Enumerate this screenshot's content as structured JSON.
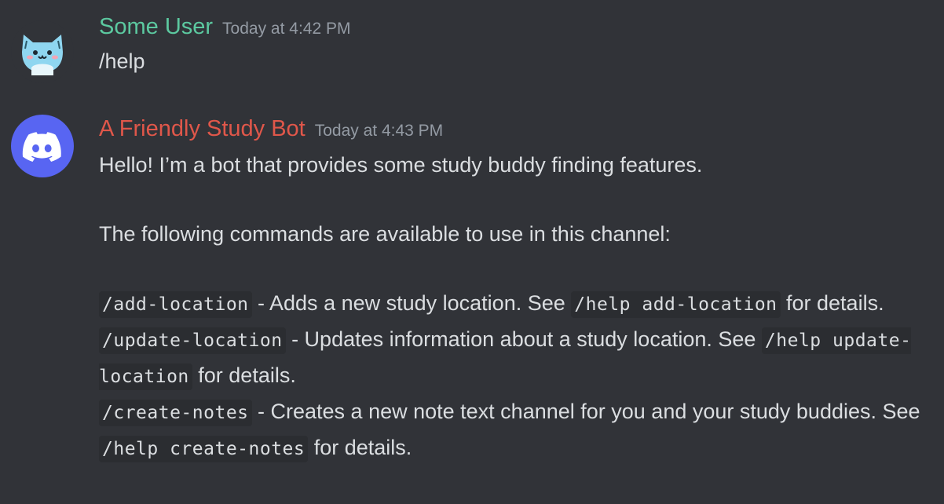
{
  "colors": {
    "background": "#313338",
    "text": "#dbdee1",
    "timestamp": "#949ba4",
    "user_name": "#5cc9a0",
    "bot_name": "#e0574a",
    "discord_blurple": "#5865f2",
    "user_avatar_bg": "#8fd6f0",
    "code_bg": "#2b2d31"
  },
  "messages": [
    {
      "author": "Some User",
      "timestamp": "Today at 4:42 PM",
      "avatar_icon": "cat-avatar-icon",
      "text": "/help"
    },
    {
      "author": "A Friendly Study Bot",
      "timestamp": "Today at 4:43 PM",
      "avatar_icon": "discord-logo-icon",
      "intro": "Hello! I’m a bot that provides some study buddy finding features.",
      "commands_intro": "The following commands are available to use in this channel:",
      "commands": [
        {
          "command": "/add-location",
          "desc_pre": " - Adds a new study location. See ",
          "help": "/help add-location",
          "desc_post": " for details."
        },
        {
          "command": "/update-location",
          "desc_pre": " - Updates information about a study location. See ",
          "help": "/help update-location",
          "desc_post": " for details."
        },
        {
          "command": "/create-notes",
          "desc_pre": " - Creates a new note text channel for you and your study buddies. See ",
          "help": "/help create-notes",
          "desc_post": " for details."
        }
      ]
    }
  ]
}
